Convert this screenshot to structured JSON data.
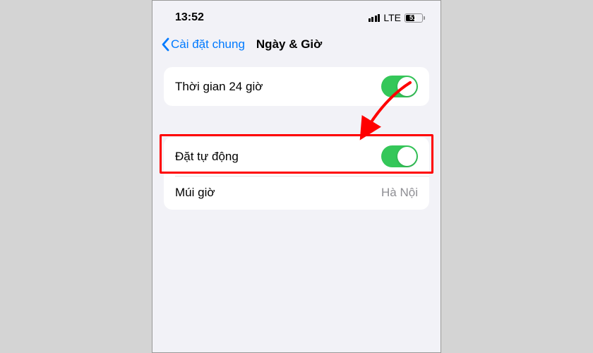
{
  "status": {
    "time": "13:52",
    "network_type": "LTE",
    "battery_percent": "51"
  },
  "nav": {
    "back_label": "Cài đặt chung",
    "title": "Ngày & Giờ"
  },
  "group1": {
    "row_24h_label": "Thời gian 24 giờ"
  },
  "group2": {
    "row_auto_label": "Đặt tự động",
    "row_tz_label": "Múi giờ",
    "row_tz_value": "Hà Nội"
  }
}
